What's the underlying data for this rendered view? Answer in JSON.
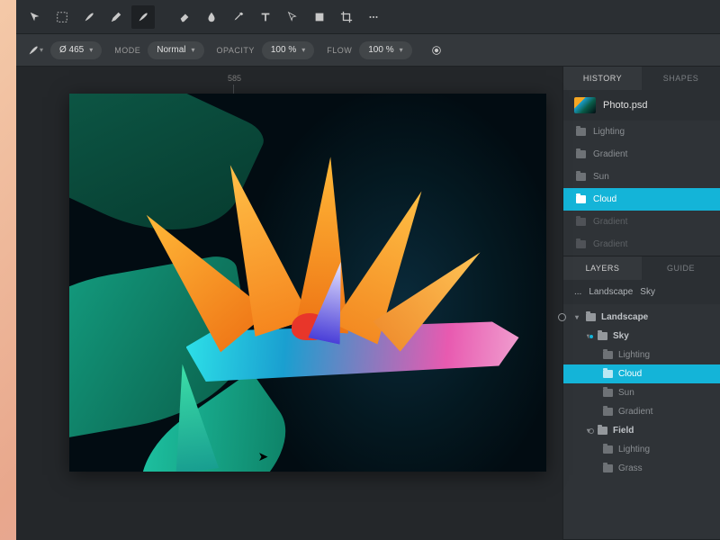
{
  "toolbar": {
    "tools": [
      "move",
      "marquee",
      "brush",
      "pencil",
      "paint",
      "eraser",
      "blur",
      "eyedropper",
      "text",
      "pointer",
      "shape",
      "crop",
      "more"
    ]
  },
  "options": {
    "brush_size": "Ø 465",
    "mode_label": "MODE",
    "mode_value": "Normal",
    "opacity_label": "OPACITY",
    "opacity_value": "100 %",
    "flow_label": "FLOW",
    "flow_value": "100 %"
  },
  "ruler": {
    "mark": "585"
  },
  "history_panel": {
    "tabs": [
      "HISTORY",
      "SHAPES"
    ],
    "active_tab": 0,
    "file_name": "Photo.psd",
    "items": [
      {
        "label": "Lighting",
        "active": false,
        "dim": false
      },
      {
        "label": "Gradient",
        "active": false,
        "dim": false
      },
      {
        "label": "Sun",
        "active": false,
        "dim": false
      },
      {
        "label": "Cloud",
        "active": true,
        "dim": false
      },
      {
        "label": "Gradient",
        "active": false,
        "dim": true
      },
      {
        "label": "Gradient",
        "active": false,
        "dim": true
      }
    ]
  },
  "layers_panel": {
    "tabs": [
      "LAYERS",
      "GUIDE"
    ],
    "active_tab": 0,
    "breadcrumb": [
      "...",
      "Landscape",
      "Sky"
    ],
    "tree": {
      "landscape": "Landscape",
      "sky": "Sky",
      "lighting": "Lighting",
      "cloud": "Cloud",
      "sun": "Sun",
      "gradient": "Gradient",
      "field": "Field",
      "lighting2": "Lighting",
      "grass": "Grass"
    }
  }
}
